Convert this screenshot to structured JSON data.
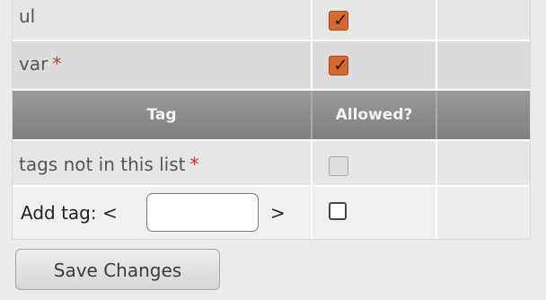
{
  "rows": [
    {
      "tag": "ul",
      "required": false,
      "allowed": true
    },
    {
      "tag": "var",
      "required": true,
      "allowed": true
    }
  ],
  "header": {
    "tag_label": "Tag",
    "allowed_label": "Allowed?"
  },
  "not_in_list": {
    "label": "tags not in this list",
    "required_mark": "*",
    "allowed": false,
    "disabled": true
  },
  "add_tag": {
    "label": "Add tag: <",
    "suffix": ">",
    "value": "",
    "checked": false
  },
  "required_mark": "*",
  "save_button": {
    "label": "Save Changes"
  },
  "colors": {
    "checked": "#d56a30",
    "required": "#c0392b",
    "header": "#8a8a8a"
  }
}
